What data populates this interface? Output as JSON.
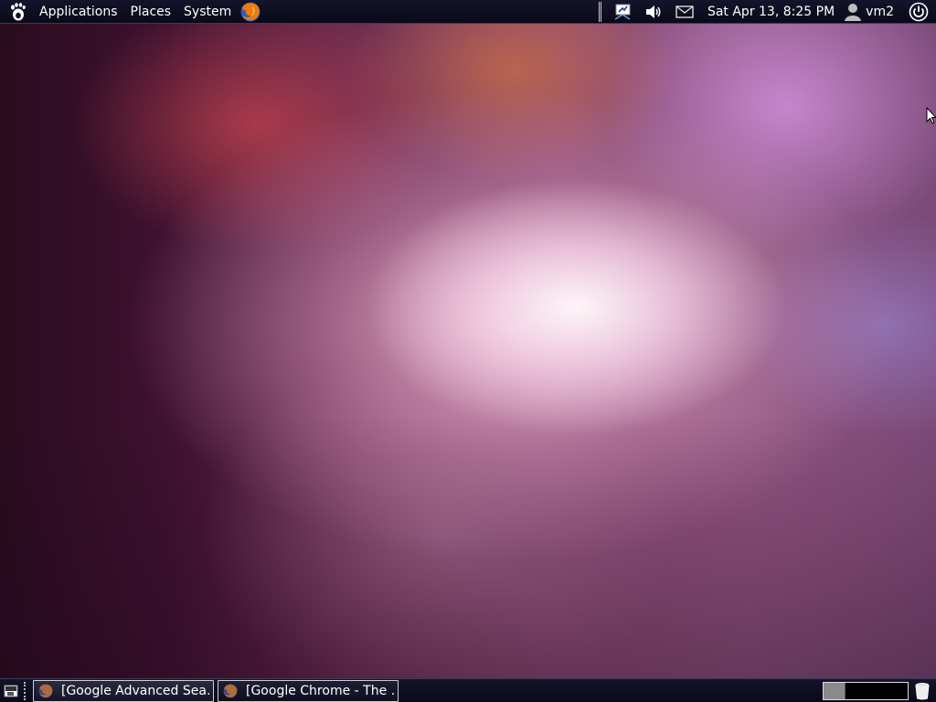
{
  "top_panel": {
    "menu": [
      "Applications",
      "Places",
      "System"
    ],
    "clock": "Sat Apr 13,  8:25 PM",
    "user": "vm2"
  },
  "bottom_panel": {
    "tasks": [
      {
        "label": "[Google Advanced Sea…"
      },
      {
        "label": "[Google Chrome - The …"
      }
    ],
    "workspaces": [
      "active",
      "inactive"
    ]
  },
  "colors": {
    "panel": "#0f0f22",
    "panel_text": "#ffffff"
  }
}
